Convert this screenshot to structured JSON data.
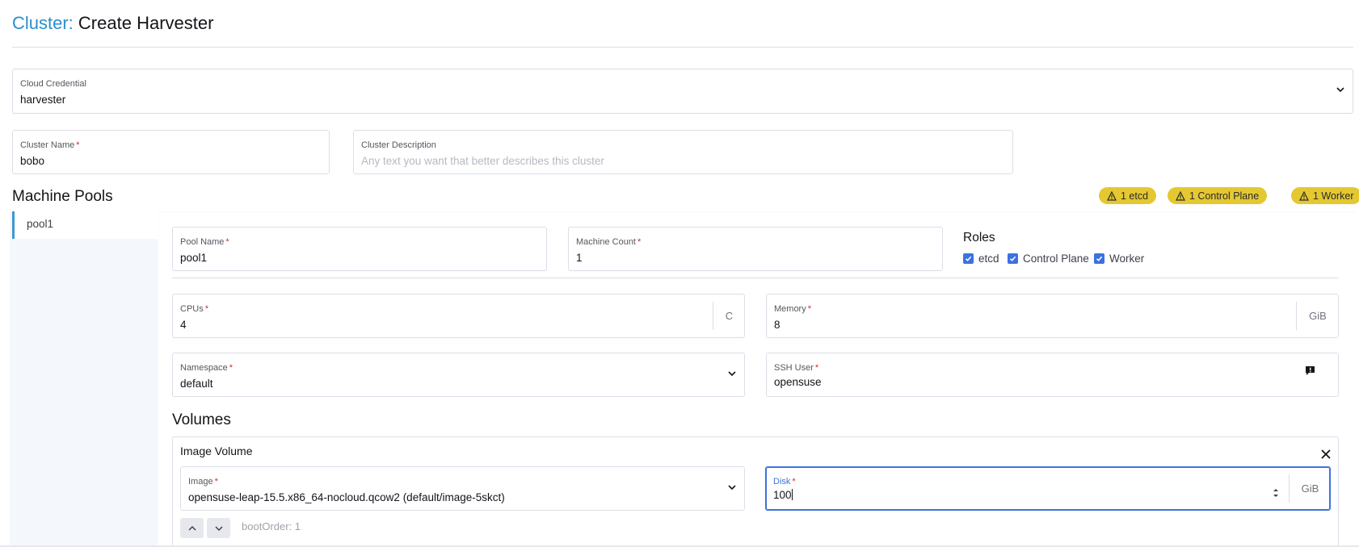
{
  "header": {
    "crumb": "Cluster:",
    "title": "Create Harvester"
  },
  "cloud_credential": {
    "label": "Cloud Credential",
    "value": "harvester"
  },
  "cluster_name": {
    "label": "Cluster Name",
    "required": "*",
    "value": "bobo"
  },
  "cluster_description": {
    "label": "Cluster Description",
    "placeholder": "Any text you want that better describes this cluster"
  },
  "machine_pools": {
    "heading": "Machine Pools",
    "badges": [
      "1 etcd",
      "1 Control Plane",
      "1 Worker"
    ],
    "tabs": [
      {
        "label": "pool1"
      }
    ]
  },
  "pool": {
    "pool_name": {
      "label": "Pool Name",
      "required": "*",
      "value": "pool1"
    },
    "machine_count": {
      "label": "Machine Count",
      "required": "*",
      "value": "1"
    },
    "roles": {
      "title": "Roles",
      "items": [
        {
          "label": "etcd",
          "checked": true
        },
        {
          "label": "Control Plane",
          "checked": true
        },
        {
          "label": "Worker",
          "checked": true
        }
      ]
    },
    "cpus": {
      "label": "CPUs",
      "required": "*",
      "value": "4",
      "suffix": "C"
    },
    "memory": {
      "label": "Memory",
      "required": "*",
      "value": "8",
      "suffix": "GiB"
    },
    "namespace": {
      "label": "Namespace",
      "required": "*",
      "value": "default"
    },
    "ssh_user": {
      "label": "SSH User",
      "required": "*",
      "value": "opensuse",
      "icon": "info-icon"
    }
  },
  "volumes": {
    "heading": "Volumes",
    "image_volume": {
      "title": "Image Volume",
      "image": {
        "label": "Image",
        "required": "*",
        "value": "opensuse-leap-15.5.x86_64-nocloud.qcow2 (default/image-5skct)"
      },
      "disk": {
        "label": "Disk",
        "required": "*",
        "value": "100",
        "suffix": "GiB"
      },
      "boot_order": "bootOrder: 1"
    }
  },
  "colors": {
    "accent": "#3b72e0",
    "crumb": "#2a8fce",
    "badge": "#e4c831",
    "required": "#d22c2c"
  }
}
